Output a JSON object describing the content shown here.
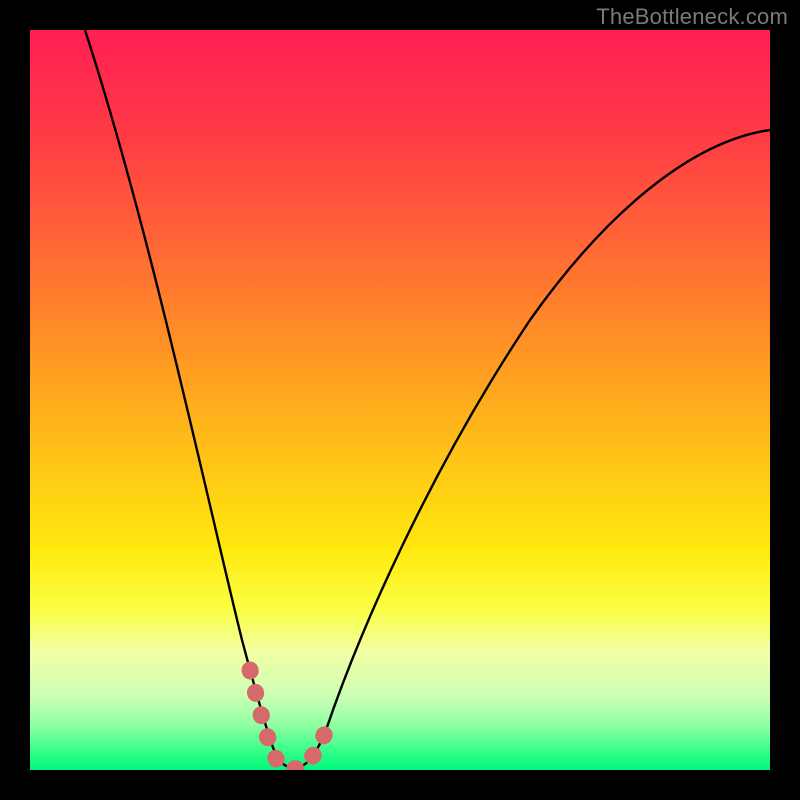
{
  "watermark": "TheBottleneck.com",
  "chart_data": {
    "type": "line",
    "title": "",
    "xlabel": "",
    "ylabel": "",
    "xlim": [
      0,
      1
    ],
    "ylim": [
      0,
      1
    ],
    "series": [
      {
        "name": "bottleneck-curve",
        "x": [
          0.08,
          0.12,
          0.16,
          0.2,
          0.24,
          0.27,
          0.29,
          0.31,
          0.33,
          0.35,
          0.37,
          0.4,
          0.45,
          0.52,
          0.6,
          0.7,
          0.82,
          0.92,
          1.0
        ],
        "y": [
          1.0,
          0.8,
          0.62,
          0.46,
          0.3,
          0.17,
          0.08,
          0.02,
          0.0,
          0.0,
          0.02,
          0.07,
          0.17,
          0.3,
          0.43,
          0.57,
          0.71,
          0.8,
          0.86
        ]
      },
      {
        "name": "highlight-dip",
        "x": [
          0.29,
          0.31,
          0.33,
          0.35,
          0.37,
          0.4
        ],
        "y": [
          0.08,
          0.02,
          0.0,
          0.0,
          0.02,
          0.07
        ]
      }
    ],
    "colors": {
      "curve": "#000000",
      "highlight": "#d66a6a",
      "gradient_top": "#ff1f54",
      "gradient_bottom": "#00f67c"
    }
  }
}
